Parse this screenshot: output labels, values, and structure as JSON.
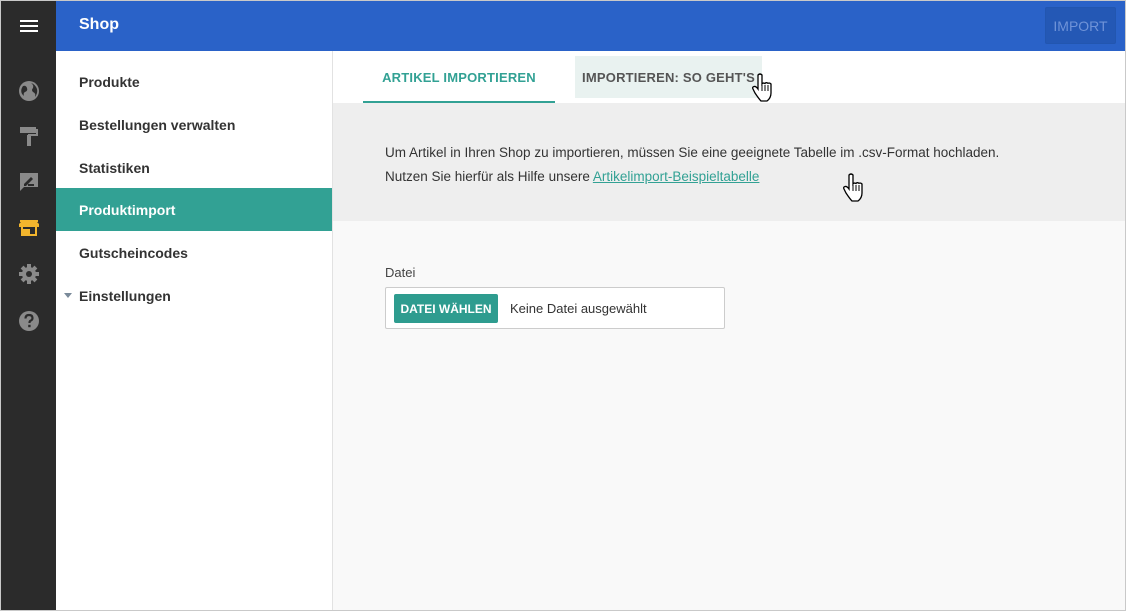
{
  "app": {
    "title": "Shop",
    "import_button": "IMPORT"
  },
  "rail": {
    "icons": [
      "menu-icon",
      "globe-icon",
      "paint-roller-icon",
      "edit-note-icon",
      "store-icon",
      "gear-icon",
      "help-icon"
    ],
    "active": "store-icon",
    "active_color": "#f2b52d"
  },
  "sidebar": {
    "items": [
      {
        "label": "Produkte"
      },
      {
        "label": "Bestellungen verwalten"
      },
      {
        "label": "Statistiken"
      },
      {
        "label": "Produktimport"
      },
      {
        "label": "Gutscheincodes"
      },
      {
        "label": "Einstellungen"
      }
    ],
    "active": "Produktimport"
  },
  "tabs": [
    {
      "label": "ARTIKEL IMPORTIEREN"
    },
    {
      "label": "IMPORTIEREN: SO GEHT'S"
    }
  ],
  "info": {
    "text_before": "Um Artikel in Ihren Shop zu importieren, müssen Sie eine geeignete Tabelle im .csv-Format hochladen. Nutzen Sie hierfür als Hilfe unsere ",
    "link": "Artikelimport-Beispieltabelle"
  },
  "file": {
    "label": "Datei",
    "button": "DATEI WÄHLEN",
    "status": "Keine Datei ausgewählt"
  },
  "colors": {
    "topbar": "#2a62c8",
    "accent": "#32a194",
    "rail": "#2b2b2b"
  }
}
